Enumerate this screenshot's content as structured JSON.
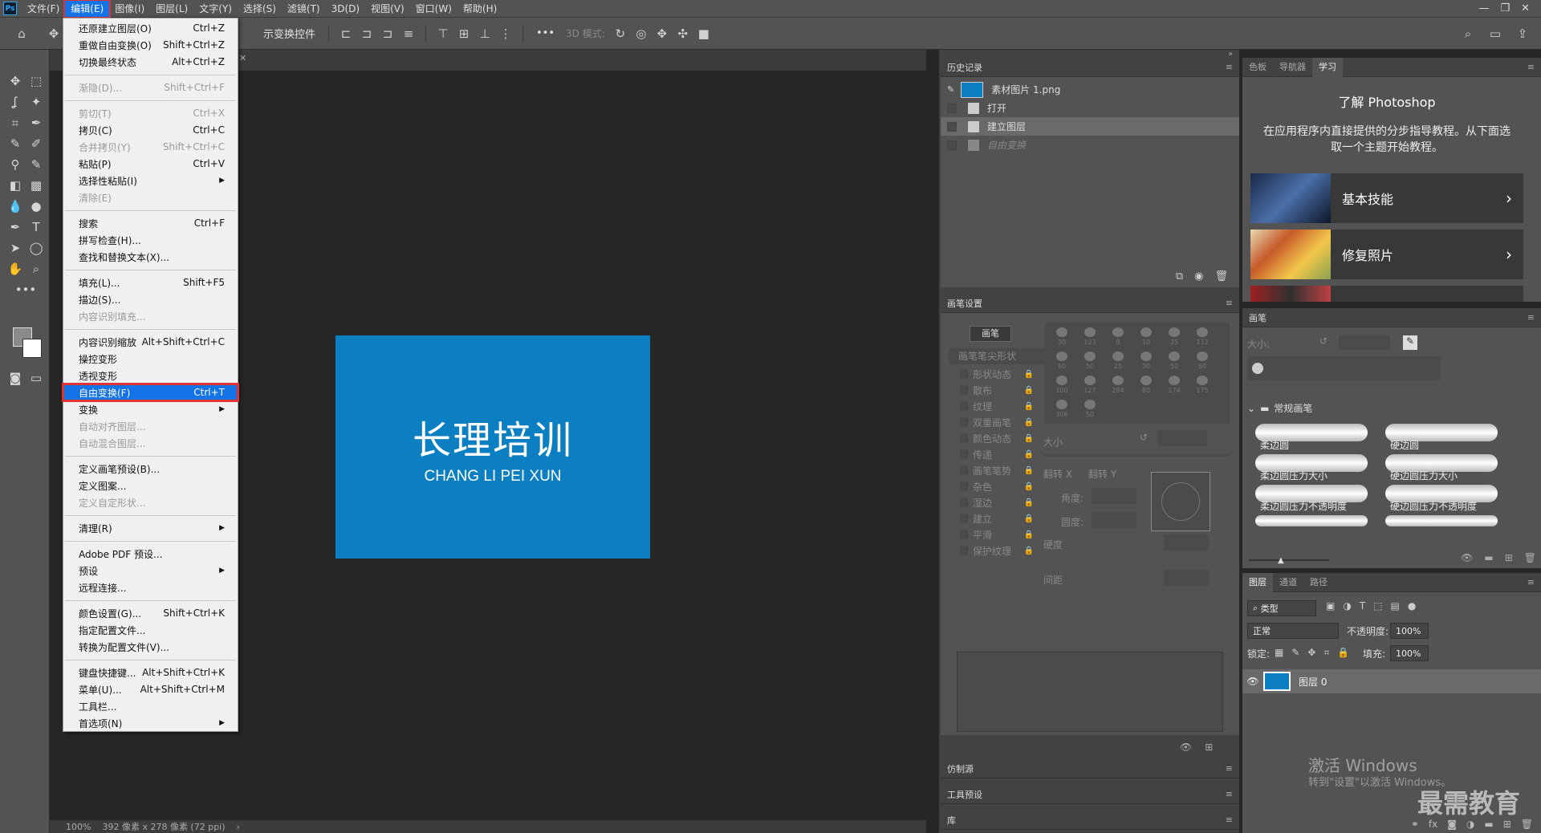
{
  "menubar": {
    "logo": "Ps",
    "items": [
      "文件(F)",
      "编辑(E)",
      "图像(I)",
      "图层(L)",
      "文字(Y)",
      "选择(S)",
      "滤镜(T)",
      "3D(D)",
      "视图(V)",
      "窗口(W)",
      "帮助(H)"
    ],
    "active_index": 1,
    "window_controls": [
      "—",
      "❐",
      "✕"
    ]
  },
  "options": {
    "transform_controls": "示变换控件",
    "mode3d": "3D 模式:",
    "more": "•••"
  },
  "tab": {
    "close": "✕"
  },
  "document": {
    "title": "长理培训",
    "subtitle": "CHANG LI PEI XUN",
    "bg_color": "#0b7fc1"
  },
  "status": {
    "zoom": "100%",
    "info": "392 像素 x 278 像素 (72 ppi)",
    "arrow": "›"
  },
  "edit_menu": {
    "rows": [
      {
        "label": "还原建立图层(O)",
        "shortcut": "Ctrl+Z",
        "disabled": false
      },
      {
        "label": "重做自由变换(O)",
        "shortcut": "Shift+Ctrl+Z",
        "disabled": false
      },
      {
        "label": "切换最终状态",
        "shortcut": "Alt+Ctrl+Z",
        "disabled": false
      },
      {
        "sep": true
      },
      {
        "label": "渐隐(D)...",
        "shortcut": "Shift+Ctrl+F",
        "disabled": true
      },
      {
        "sep": true
      },
      {
        "label": "剪切(T)",
        "shortcut": "Ctrl+X",
        "disabled": true
      },
      {
        "label": "拷贝(C)",
        "shortcut": "Ctrl+C",
        "disabled": false
      },
      {
        "label": "合并拷贝(Y)",
        "shortcut": "Shift+Ctrl+C",
        "disabled": true
      },
      {
        "label": "粘贴(P)",
        "shortcut": "Ctrl+V",
        "disabled": false
      },
      {
        "label": "选择性粘贴(I)",
        "shortcut": "",
        "submenu": true,
        "disabled": false
      },
      {
        "label": "清除(E)",
        "shortcut": "",
        "disabled": true
      },
      {
        "sep": true
      },
      {
        "label": "搜索",
        "shortcut": "Ctrl+F",
        "disabled": false
      },
      {
        "label": "拼写检查(H)...",
        "shortcut": "",
        "disabled": false
      },
      {
        "label": "查找和替换文本(X)...",
        "shortcut": "",
        "disabled": false
      },
      {
        "sep": true
      },
      {
        "label": "填充(L)...",
        "shortcut": "Shift+F5",
        "disabled": false
      },
      {
        "label": "描边(S)...",
        "shortcut": "",
        "disabled": false
      },
      {
        "label": "内容识别填充...",
        "shortcut": "",
        "disabled": true
      },
      {
        "sep": true
      },
      {
        "label": "内容识别缩放",
        "shortcut": "Alt+Shift+Ctrl+C",
        "disabled": false
      },
      {
        "label": "操控变形",
        "shortcut": "",
        "disabled": false
      },
      {
        "label": "透视变形",
        "shortcut": "",
        "disabled": false
      },
      {
        "label": "自由变换(F)",
        "shortcut": "Ctrl+T",
        "selected": true,
        "disabled": false
      },
      {
        "label": "变换",
        "shortcut": "",
        "submenu": true,
        "disabled": false
      },
      {
        "label": "自动对齐图层...",
        "shortcut": "",
        "disabled": true
      },
      {
        "label": "自动混合图层...",
        "shortcut": "",
        "disabled": true
      },
      {
        "sep": true
      },
      {
        "label": "定义画笔预设(B)...",
        "shortcut": "",
        "disabled": false
      },
      {
        "label": "定义图案...",
        "shortcut": "",
        "disabled": false
      },
      {
        "label": "定义自定形状...",
        "shortcut": "",
        "disabled": true
      },
      {
        "sep": true
      },
      {
        "label": "清理(R)",
        "shortcut": "",
        "submenu": true,
        "disabled": false
      },
      {
        "sep": true
      },
      {
        "label": "Adobe PDF 预设...",
        "shortcut": "",
        "disabled": false
      },
      {
        "label": "预设",
        "shortcut": "",
        "submenu": true,
        "disabled": false
      },
      {
        "label": "远程连接...",
        "shortcut": "",
        "disabled": false
      },
      {
        "sep": true
      },
      {
        "label": "颜色设置(G)...",
        "shortcut": "Shift+Ctrl+K",
        "disabled": false
      },
      {
        "label": "指定配置文件...",
        "shortcut": "",
        "disabled": false
      },
      {
        "label": "转换为配置文件(V)...",
        "shortcut": "",
        "disabled": false
      },
      {
        "sep": true
      },
      {
        "label": "键盘快捷键...",
        "shortcut": "Alt+Shift+Ctrl+K",
        "disabled": false
      },
      {
        "label": "菜单(U)...",
        "shortcut": "Alt+Shift+Ctrl+M",
        "disabled": false
      },
      {
        "label": "工具栏...",
        "shortcut": "",
        "disabled": false
      },
      {
        "label": "首选项(N)",
        "shortcut": "",
        "submenu": true,
        "disabled": false
      }
    ]
  },
  "history": {
    "title": "历史记录",
    "snapshot": "素材图片 1.png",
    "steps": [
      "打开",
      "建立图层",
      "自由变换"
    ]
  },
  "brush_settings": {
    "title": "画笔设置",
    "brush_btn": "画笔",
    "tip_shape": "画笔笔尖形状",
    "options": [
      "形状动态",
      "散布",
      "纹理",
      "双重画笔",
      "颜色动态",
      "传递",
      "画笔笔势",
      "杂色",
      "湿边",
      "建立",
      "平滑",
      "保护纹理"
    ],
    "sizes": [
      "30",
      "123",
      "8",
      "10",
      "25",
      "112",
      "60",
      "50",
      "25",
      "30",
      "50",
      "60",
      "100",
      "127",
      "284",
      "80",
      "174",
      "175",
      "306",
      "50"
    ],
    "size_label": "大小",
    "flip_x": "翻转 X",
    "flip_y": "翻转 Y",
    "angle": "角度:",
    "roundness": "圆度:",
    "hardness": "硬度",
    "spacing": "间距"
  },
  "clone_source": {
    "title": "仿制源"
  },
  "tool_presets": {
    "title": "工具预设"
  },
  "library": {
    "title": "库"
  },
  "learn": {
    "tabs": [
      "色板",
      "导航器",
      "学习"
    ],
    "active_tab": 2,
    "heading": "了解 Photoshop",
    "desc": "在应用程序内直接提供的分步指导教程。从下面选取一个主题开始教程。",
    "cards": [
      "基本技能",
      "修复照片"
    ]
  },
  "brushes": {
    "title": "画笔",
    "size_label": "大小:",
    "group": "常规画笔",
    "items": [
      "柔边圆",
      "硬边圆",
      "柔边圆压力大小",
      "硬边圆压力大小",
      "柔边圆压力不透明度",
      "硬边圆压力不透明度"
    ]
  },
  "layers": {
    "tabs": [
      "图层",
      "通道",
      "路径"
    ],
    "active_tab": 0,
    "filter": "类型",
    "blend_mode": "正常",
    "opacity_label": "不透明度:",
    "opacity": "100%",
    "lock_label": "锁定:",
    "fill_label": "填充:",
    "fill": "100%",
    "layer_name": "图层 0"
  },
  "watermark": {
    "activate": "激活 Windows",
    "activate_sub": "转到\"设置\"以激活 Windows。",
    "brand": "最需教育"
  }
}
